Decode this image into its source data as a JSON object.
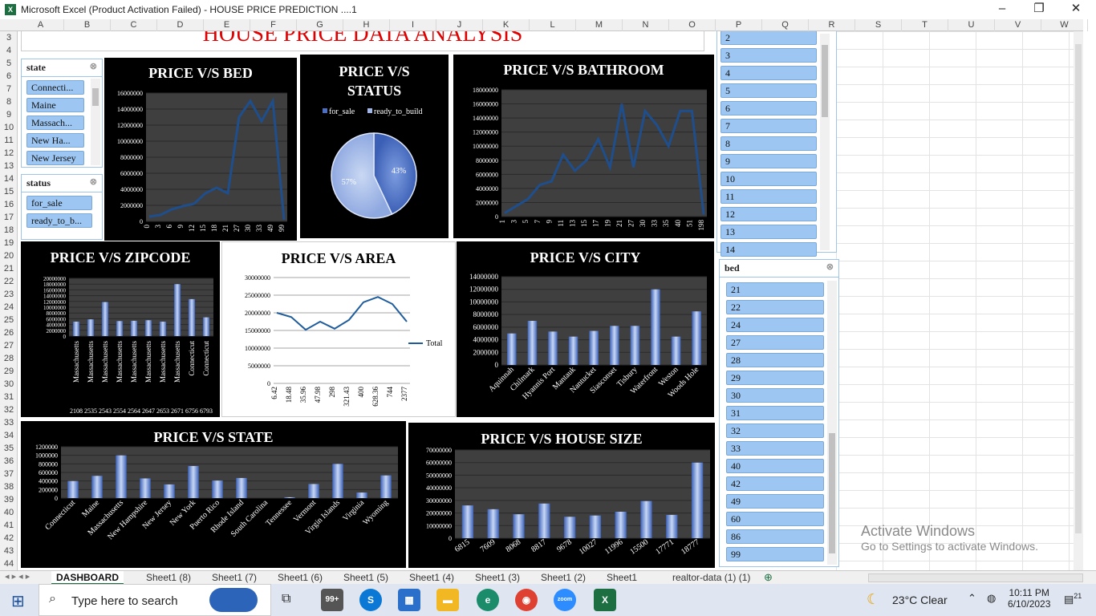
{
  "window": {
    "title": "Microsoft Excel (Product Activation Failed) - HOUSE PRICE PREDICTION ....1"
  },
  "columns": [
    "A",
    "B",
    "C",
    "D",
    "E",
    "F",
    "G",
    "H",
    "I",
    "J",
    "K",
    "L",
    "M",
    "N",
    "O",
    "P",
    "Q",
    "R",
    "S",
    "T",
    "U",
    "V",
    "W"
  ],
  "rows": [
    "3",
    "4",
    "5",
    "6",
    "7",
    "8",
    "9",
    "10",
    "11",
    "12",
    "13",
    "14",
    "15",
    "16",
    "17",
    "18",
    "19",
    "20",
    "21",
    "22",
    "23",
    "24",
    "25",
    "26",
    "27",
    "28",
    "29",
    "30",
    "31",
    "32",
    "33",
    "34",
    "35",
    "36",
    "37",
    "38",
    "39",
    "40",
    "41",
    "42",
    "43",
    "44"
  ],
  "dashboard_title": "HOUSE PRICE DATA ANALYSIS",
  "state_slicer": {
    "header": "state",
    "items": [
      "Connecti...",
      "Maine",
      "Massach...",
      "New Ha...",
      "New Jersey"
    ]
  },
  "status_slicer": {
    "header": "status",
    "items": [
      "for_sale",
      "ready_to_b..."
    ]
  },
  "p_slicer": {
    "items": [
      "2",
      "3",
      "4",
      "5",
      "6",
      "7",
      "8",
      "9",
      "10",
      "11",
      "12",
      "13",
      "14"
    ]
  },
  "bed_slicer": {
    "header": "bed",
    "items": [
      "21",
      "22",
      "24",
      "27",
      "28",
      "29",
      "30",
      "31",
      "32",
      "33",
      "40",
      "42",
      "49",
      "60",
      "86",
      "99"
    ]
  },
  "chart_data": [
    {
      "id": "bed",
      "type": "line",
      "title": "PRICE V/S BED",
      "x": [
        "0",
        "3",
        "6",
        "9",
        "12",
        "15",
        "18",
        "21",
        "27",
        "30",
        "33",
        "49",
        "99"
      ],
      "values": [
        600000,
        800000,
        1500000,
        1900000,
        2200000,
        3500000,
        4200000,
        3500000,
        13000000,
        15000000,
        12500000,
        15000000,
        200000
      ],
      "ylim": [
        0,
        16000000
      ],
      "yticks": [
        "0",
        "2000000",
        "4000000",
        "6000000",
        "8000000",
        "10000000",
        "12000000",
        "14000000",
        "16000000"
      ]
    },
    {
      "id": "status",
      "type": "pie",
      "title": "PRICE V/S STATUS",
      "legend": [
        "for_sale",
        "ready_to_build"
      ],
      "values": [
        43,
        57
      ],
      "labels": [
        "43%",
        "57%"
      ]
    },
    {
      "id": "bathroom",
      "type": "line",
      "title": "PRICE V/S BATHROOM",
      "x": [
        "1",
        "3",
        "5",
        "7",
        "9",
        "11",
        "13",
        "15",
        "17",
        "19",
        "21",
        "27",
        "30",
        "33",
        "35",
        "40",
        "51",
        "198"
      ],
      "values": [
        500000,
        1500000,
        2500000,
        4500000,
        5000000,
        8800000,
        6500000,
        8000000,
        11000000,
        7000000,
        16000000,
        7000000,
        15000000,
        13000000,
        10000000,
        15000000,
        15000000,
        300000
      ],
      "ylim": [
        0,
        18000000
      ],
      "yticks": [
        "0",
        "2000000",
        "4000000",
        "6000000",
        "8000000",
        "10000000",
        "12000000",
        "14000000",
        "16000000",
        "18000000"
      ]
    },
    {
      "id": "zipcode",
      "type": "bar",
      "title": "PRICE V/S ZIPCODE",
      "categories": [
        "Massachusetts",
        "Massachusetts",
        "Massachusetts",
        "Massachusetts",
        "Massachusetts",
        "Massachusetts",
        "Massachusetts",
        "Massachusetts",
        "Connecticut",
        "Connecticut"
      ],
      "sublabels": [
        "2108",
        "2535",
        "2543",
        "2554",
        "2564",
        "2647",
        "2653",
        "2671",
        "6756",
        "6793"
      ],
      "values": [
        5000000,
        5800000,
        11800000,
        5200000,
        5300000,
        5500000,
        5000000,
        18000000,
        12800000,
        6500000
      ],
      "ylim": [
        0,
        20000000
      ],
      "yticks": [
        "0",
        "2000000",
        "4000000",
        "6000000",
        "8000000",
        "10000000",
        "12000000",
        "14000000",
        "16000000",
        "18000000",
        "20000000"
      ]
    },
    {
      "id": "area",
      "type": "line",
      "title": "PRICE V/S AREA",
      "x": [
        "6.42",
        "18.48",
        "35.96",
        "47.98",
        "298",
        "321.43",
        "400",
        "628.36",
        "744",
        "2377"
      ],
      "values": [
        20000000,
        18800000,
        15200000,
        17500000,
        15500000,
        18000000,
        23000000,
        24500000,
        22500000,
        17500000
      ],
      "series": "Total",
      "ylim": [
        0,
        30000000
      ],
      "yticks": [
        "0",
        "5000000",
        "10000000",
        "15000000",
        "20000000",
        "25000000",
        "30000000"
      ]
    },
    {
      "id": "city",
      "type": "bar",
      "title": "PRICE V/S CITY",
      "categories": [
        "Aquinnah",
        "Chilmark",
        "Hyannis Port",
        "Mantauk",
        "Nantucket",
        "Siasconset",
        "Tisbury",
        "Waterfront",
        "Weston",
        "Woods Hole"
      ],
      "values": [
        5000000,
        7000000,
        5300000,
        4500000,
        5400000,
        6200000,
        6200000,
        12000000,
        4500000,
        8500000
      ],
      "ylim": [
        0,
        14000000
      ],
      "yticks": [
        "0",
        "2000000",
        "4000000",
        "6000000",
        "8000000",
        "10000000",
        "12000000",
        "14000000"
      ]
    },
    {
      "id": "state",
      "type": "bar",
      "title": "PRICE V/S STATE",
      "categories": [
        "Connecticut",
        "Maine",
        "Massachusetts",
        "New Hampshire",
        "New Jersey",
        "New York",
        "Puerto Rico",
        "Rhode Island",
        "South Carolina",
        "Tennessee",
        "Vermont",
        "Virgin Islands",
        "Virginia",
        "Wyoming"
      ],
      "values": [
        400000,
        520000,
        1000000,
        460000,
        320000,
        750000,
        410000,
        470000,
        0,
        20000,
        330000,
        800000,
        130000,
        530000
      ],
      "ylim": [
        0,
        1200000
      ],
      "yticks": [
        "0",
        "200000",
        "400000",
        "600000",
        "800000",
        "1000000",
        "1200000"
      ]
    },
    {
      "id": "housesize",
      "type": "bar",
      "title": "PRICE V/S HOUSE SIZE",
      "categories": [
        "6815",
        "7609",
        "8068",
        "8817",
        "9678",
        "10027",
        "11996",
        "15500",
        "17771",
        "18777"
      ],
      "values": [
        26000000,
        23000000,
        19000000,
        27500000,
        17000000,
        18000000,
        21000000,
        29500000,
        18500000,
        60000000
      ],
      "ylim": [
        0,
        70000000
      ],
      "yticks": [
        "0",
        "10000000",
        "20000000",
        "30000000",
        "40000000",
        "50000000",
        "60000000",
        "70000000"
      ]
    }
  ],
  "tabs": [
    "DASHBOARD",
    "Sheet1 (8)",
    "Sheet1 (7)",
    "Sheet1 (6)",
    "Sheet1 (5)",
    "Sheet1 (4)",
    "Sheet1 (3)",
    "Sheet1 (2)",
    "Sheet1",
    "realtor-data (1) (1)"
  ],
  "watermark": {
    "line1": "Activate Windows",
    "line2": "Go to Settings to activate Windows."
  },
  "taskbar": {
    "search": "Type here to search",
    "badge": "99+",
    "weather": "23°C  Clear",
    "time": "10:11 PM",
    "date": "6/10/2023",
    "notif": "21"
  },
  "colors": {
    "bar": "#4a78c8",
    "line": "#1f4e8c",
    "panel": "#000000",
    "plot": "#3f3f3f",
    "slicer_item": "#9dc7f2"
  }
}
